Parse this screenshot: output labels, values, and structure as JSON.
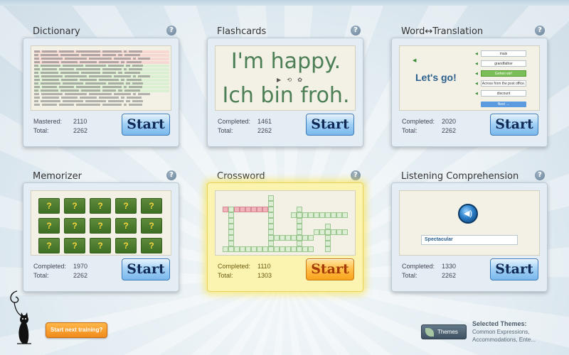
{
  "cards": [
    {
      "title": "Dictionary",
      "stat1_label": "Mastered:",
      "stat1_value": "2110",
      "stat2_label": "Total:",
      "stat2_value": "2262",
      "start": "Start"
    },
    {
      "title": "Flashcards",
      "stat1_label": "Completed:",
      "stat1_value": "1461",
      "stat2_label": "Total:",
      "stat2_value": "2262",
      "start": "Start"
    },
    {
      "title": "Word↔Translation",
      "stat1_label": "Completed:",
      "stat1_value": "2020",
      "stat2_label": "Total:",
      "stat2_value": "2262",
      "start": "Start"
    },
    {
      "title": "Memorizer",
      "stat1_label": "Completed:",
      "stat1_value": "1970",
      "stat2_label": "Total:",
      "stat2_value": "2262",
      "start": "Start"
    },
    {
      "title": "Crossword",
      "stat1_label": "Completed:",
      "stat1_value": "1110",
      "stat2_label": "Total:",
      "stat2_value": "1303",
      "start": "Start"
    },
    {
      "title": "Listening Comprehension",
      "stat1_label": "Completed:",
      "stat1_value": "1330",
      "stat2_label": "Total:",
      "stat2_value": "2262",
      "start": "Start"
    }
  ],
  "help_glyph": "?",
  "flashcards": {
    "line1": "I'm happy.",
    "line2": "Ich bin froh.",
    "controls": "▶ ⟲ ✿"
  },
  "word_translation": {
    "prompt": "Let's go!",
    "options": [
      "mais",
      "grandfather",
      "Gehen wir!",
      "Across from the post office.",
      "discount"
    ],
    "next": "Next →"
  },
  "memorizer": {
    "card_glyph": "?"
  },
  "listening": {
    "answer": "Spectacular",
    "play_glyph": "◀)"
  },
  "bottom": {
    "start_next": "Start next training?",
    "themes_button": "Themes",
    "selected_title": "Selected Themes:",
    "selected_list": "Common Expressions, Accommodations, Ente..."
  },
  "colors": {
    "start_blue": "#7ab8ec",
    "start_orange": "#f8a21c",
    "crossword_highlight": "#fbf3b0"
  }
}
